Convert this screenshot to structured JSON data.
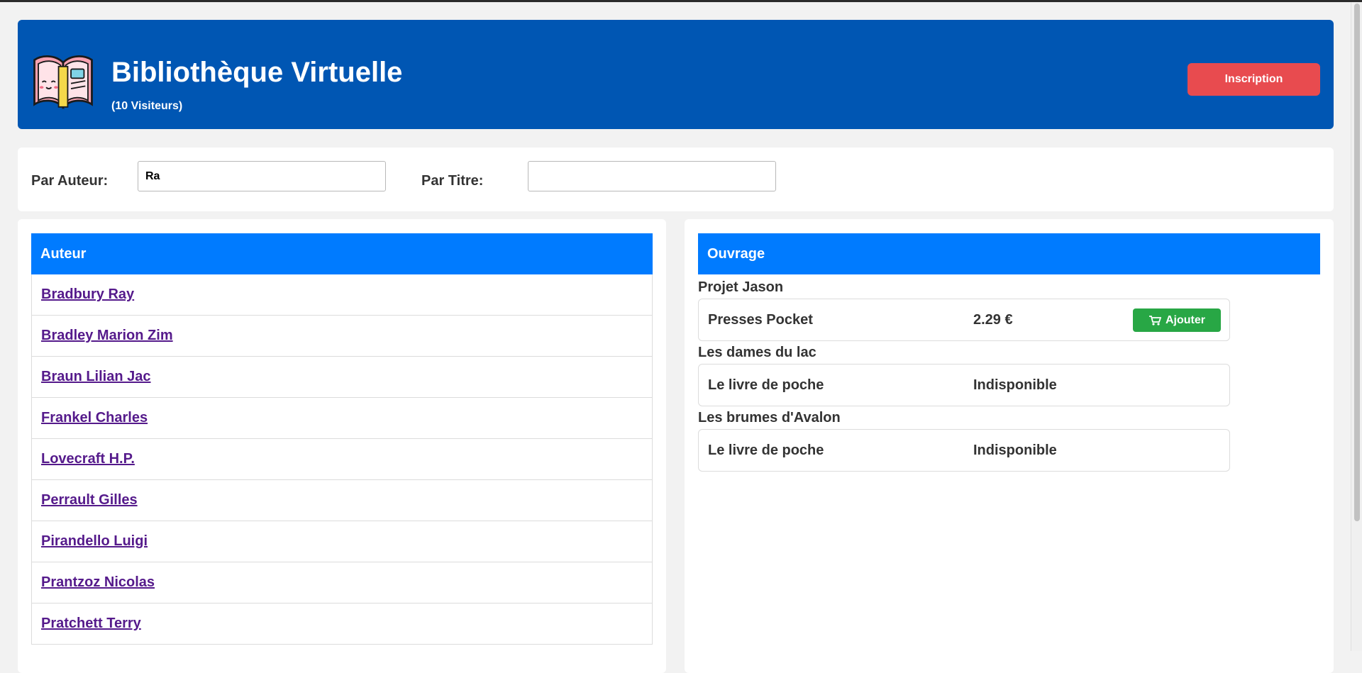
{
  "header": {
    "title": "Bibliothèque Virtuelle",
    "visitors": "(10 Visiteurs)",
    "signup_label": "Inscription",
    "logo_icon": "open-book-icon",
    "colors": {
      "background": "#0056b3",
      "signup": "#e84b4f"
    }
  },
  "filters": {
    "author_label": "Par Auteur:",
    "author_value": "Ra",
    "title_label": "Par Titre:",
    "title_value": ""
  },
  "authors": {
    "header": "Auteur",
    "items": [
      "Bradbury Ray",
      "Bradley Marion Zim",
      "Braun Lilian Jac",
      "Frankel Charles",
      "Lovecraft H.P.",
      "Perrault Gilles",
      "Pirandello Luigi",
      "Prantzoz Nicolas",
      "Pratchett Terry"
    ]
  },
  "works": {
    "header": "Ouvrage",
    "items": [
      {
        "title": "Projet Jason",
        "publisher": "Presses Pocket",
        "status": "2.29 €",
        "add_label": "Ajouter",
        "add_icon": "cart-icon"
      },
      {
        "title": "Les dames du lac",
        "publisher": "Le livre de poche",
        "status": "Indisponible"
      },
      {
        "title": "Les brumes d'Avalon",
        "publisher": "Le livre de poche",
        "status": "Indisponible"
      }
    ],
    "colors": {
      "header": "#007bff",
      "add_button": "#28a745"
    }
  }
}
